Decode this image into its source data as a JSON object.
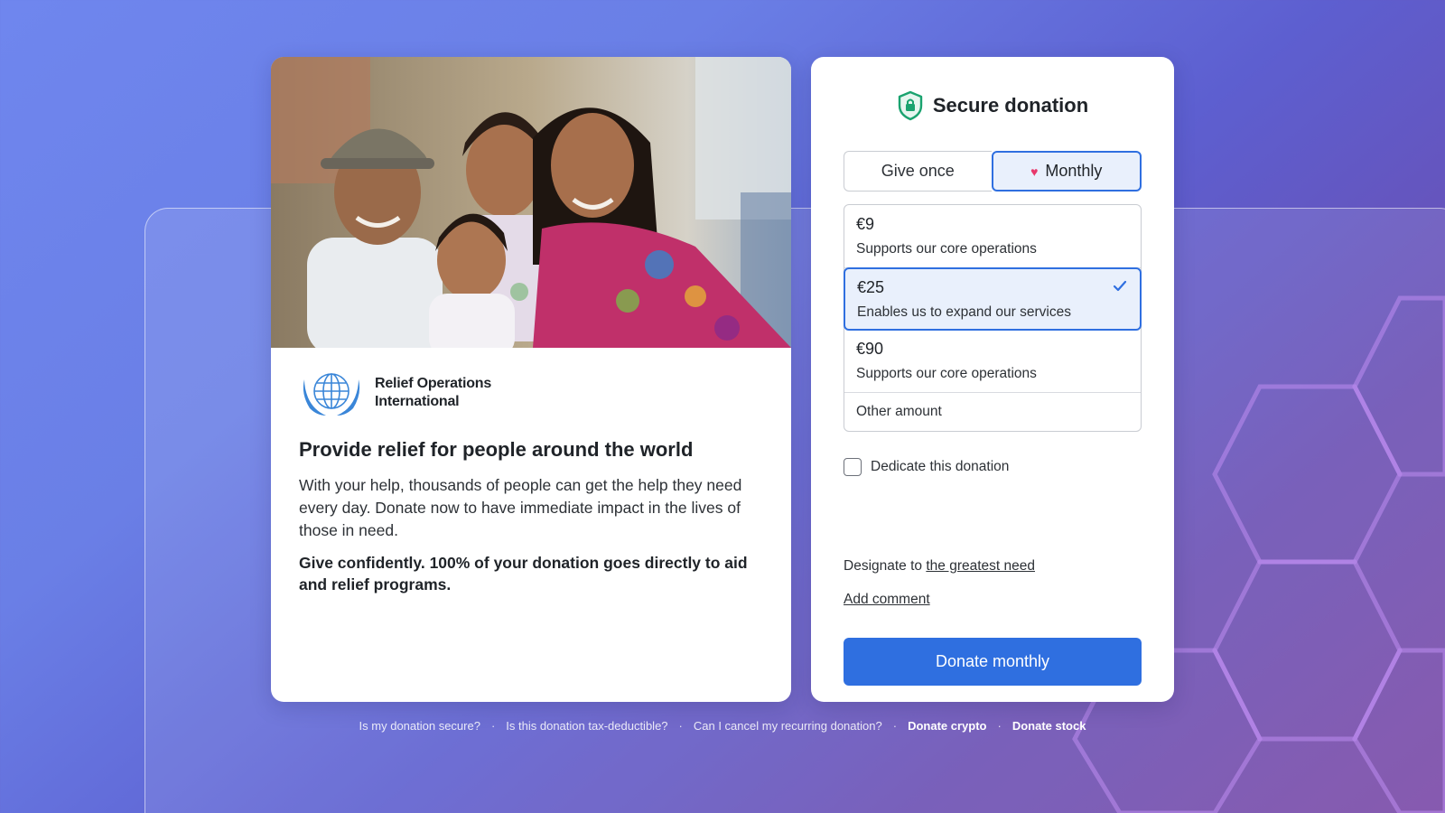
{
  "organization": {
    "name": "Relief Operations International"
  },
  "campaign": {
    "headline": "Provide relief for people around the world",
    "description": "With your help, thousands of people can get the help they need every day. Donate now to have immediate impact in the lives of those in need.",
    "trust_statement": "Give confidently. 100% of your donation goes directly to aid and relief programs."
  },
  "form": {
    "title": "Secure donation",
    "frequency": {
      "options": [
        "Give once",
        "Monthly"
      ],
      "selected": "Monthly"
    },
    "amounts": [
      {
        "value": "€9",
        "description": "Supports our core operations",
        "selected": false
      },
      {
        "value": "€25",
        "description": "Enables us to expand our services",
        "selected": true
      },
      {
        "value": "€90",
        "description": "Supports our core operations",
        "selected": false
      }
    ],
    "other_amount_label": "Other amount",
    "dedicate_label": "Dedicate this donation",
    "dedicate_checked": false,
    "designate_prefix": "Designate to",
    "designate_link": "the greatest need",
    "add_comment": "Add comment",
    "submit_label": "Donate monthly"
  },
  "footer": {
    "links": [
      {
        "label": "Is my donation secure?",
        "strong": false
      },
      {
        "label": "Is this donation tax-deductible?",
        "strong": false
      },
      {
        "label": "Can I cancel my recurring donation?",
        "strong": false
      },
      {
        "label": "Donate crypto",
        "strong": true
      },
      {
        "label": "Donate stock",
        "strong": true
      }
    ]
  },
  "colors": {
    "accent": "#2f6fe0",
    "selected_bg": "#e9f0fc",
    "shield": "#1aa36f",
    "heart": "#e8386b"
  }
}
